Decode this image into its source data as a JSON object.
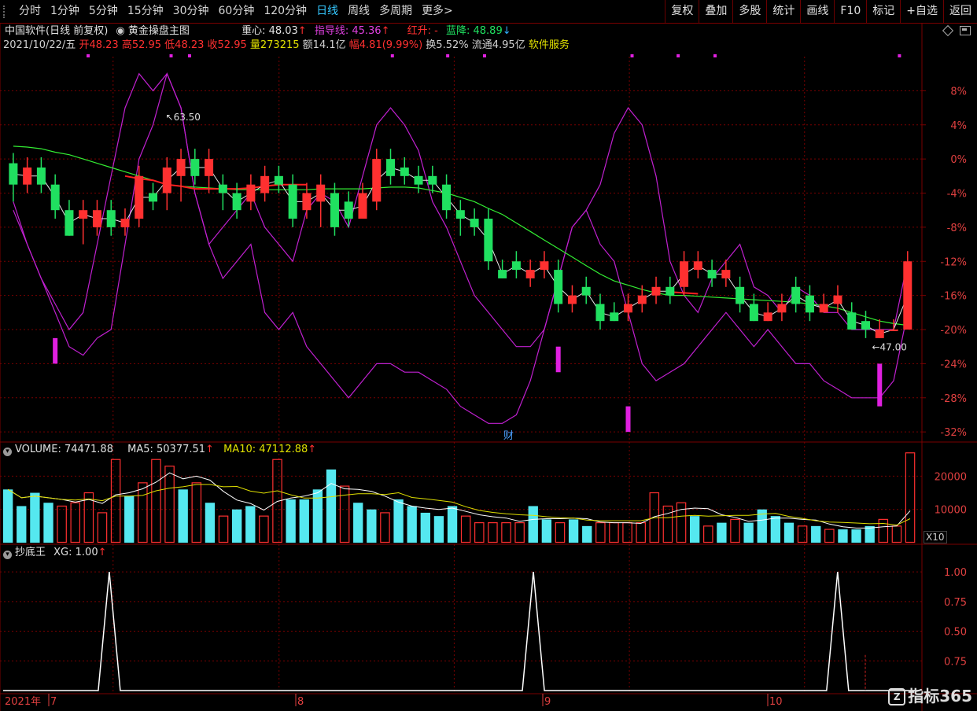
{
  "toolbar": {
    "periods": [
      "分时",
      "1分钟",
      "5分钟",
      "15分钟",
      "30分钟",
      "60分钟",
      "120分钟",
      "日线",
      "周线",
      "多周期",
      "更多>"
    ],
    "active_period": "日线",
    "buttons": [
      "复权",
      "叠加",
      "多股",
      "统计",
      "画线",
      "F10",
      "标记",
      "+自选",
      "返回"
    ]
  },
  "header": {
    "stock_name": "中国软件(日线 前复权)",
    "indicator_name": "黄金操盘主图",
    "zhongxin_label": "重心: 48.03",
    "zhidao_label": "指导线: 45.36",
    "hongsheng_label": "红升: -",
    "lanjiang_label": "蓝降: 48.89",
    "date": "2021/10/22/五",
    "open": "开48.23",
    "high": "高52.95",
    "low": "低48.23",
    "close": "收52.95",
    "volume": "量273215",
    "amount": "额14.1亿",
    "change": "幅4.81(9.99%)",
    "turnover": "换5.52%",
    "float": "流通4.95亿",
    "sector": "软件服务"
  },
  "main_axis": {
    "ticks": [
      "8%",
      "4%",
      "0%",
      "-4%",
      "-8%",
      "-12%",
      "-16%",
      "-20%",
      "-24%",
      "-28%",
      "-32%"
    ],
    "tick_values": [
      8,
      4,
      0,
      -4,
      -8,
      -12,
      -16,
      -20,
      -24,
      -28,
      -32
    ],
    "high_note": "63.50",
    "low_note": "47.00",
    "cai_marker": "财"
  },
  "volume_panel": {
    "title": "VOLUME: 74471.88",
    "ma5": "MA5: 50377.51",
    "ma10": "MA10: 47112.88",
    "ticks": [
      "20000",
      "10000"
    ],
    "unit_badge": "X10"
  },
  "xg_panel": {
    "title": "抄底王",
    "xg": "XG: 1.00",
    "ticks": [
      "1.00",
      "0.75",
      "0.50",
      "0.75"
    ]
  },
  "dates": {
    "labels": [
      "2021年",
      "7",
      "8",
      "9",
      "10"
    ]
  },
  "watermark": {
    "icon": "Z",
    "text": "指标365"
  },
  "colors": {
    "up": "#ff3030",
    "down": "#20e060",
    "magenta": "#e020e0",
    "green_line": "#33ee33",
    "red_line": "#ff2020",
    "grid": "#7a0000"
  },
  "chart_data": {
    "type": "candlestick",
    "title": "黄金操盘主图",
    "y_unit": "%",
    "ylim": [
      -33,
      12
    ],
    "candles": [
      [
        1,
        -0.5,
        -3,
        -5,
        "d"
      ],
      [
        2,
        -3,
        -1,
        -4,
        "u"
      ],
      [
        3,
        -1,
        -3,
        -4,
        "d"
      ],
      [
        4,
        -3,
        -6,
        -7,
        "d"
      ],
      [
        5,
        -6,
        -9,
        -9,
        "d"
      ],
      [
        6,
        -7,
        -6,
        -10,
        "u"
      ],
      [
        7,
        -8,
        -6,
        -9,
        "u"
      ],
      [
        8,
        -6,
        -8,
        -9,
        "d"
      ],
      [
        9,
        -8,
        -7,
        -9,
        "u"
      ],
      [
        10,
        -7,
        -2,
        -8,
        "u"
      ],
      [
        11,
        -4,
        -5,
        -6,
        "d"
      ],
      [
        12,
        -4,
        -1,
        -6,
        "u"
      ],
      [
        13,
        -2,
        0,
        -5,
        "u"
      ],
      [
        14,
        0,
        -2,
        -3,
        "d"
      ],
      [
        15,
        -2,
        0,
        -4,
        "u"
      ],
      [
        16,
        -3,
        -4,
        -6,
        "d"
      ],
      [
        17,
        -4,
        -6,
        -7,
        "d"
      ],
      [
        18,
        -5,
        -3,
        -6,
        "u"
      ],
      [
        19,
        -4,
        -2,
        -5,
        "u"
      ],
      [
        20,
        -2,
        -3,
        -4,
        "d"
      ],
      [
        21,
        -3,
        -7,
        -8,
        "d"
      ],
      [
        22,
        -6,
        -4,
        -7,
        "u"
      ],
      [
        23,
        -5,
        -3,
        -8,
        "u"
      ],
      [
        24,
        -4,
        -8,
        -9,
        "d"
      ],
      [
        25,
        -5,
        -7,
        -8,
        "d"
      ],
      [
        26,
        -7,
        -4,
        -7,
        "u"
      ],
      [
        27,
        -5,
        0,
        -6,
        "u"
      ],
      [
        28,
        0,
        -2,
        -3,
        "d"
      ],
      [
        29,
        -1,
        -2,
        -3,
        "d"
      ],
      [
        30,
        -2,
        -3,
        -4,
        "d"
      ],
      [
        31,
        -2,
        -3,
        -4,
        "d"
      ],
      [
        32,
        -3,
        -6,
        -7,
        "d"
      ],
      [
        33,
        -6,
        -7,
        -9,
        "d"
      ],
      [
        34,
        -7,
        -8,
        -9,
        "d"
      ],
      [
        35,
        -7,
        -12,
        -13,
        "d"
      ],
      [
        36,
        -13,
        -14,
        -14,
        "d"
      ],
      [
        37,
        -12,
        -13,
        -14,
        "d"
      ],
      [
        38,
        -14,
        -13,
        -15,
        "u"
      ],
      [
        39,
        -13,
        -12,
        -14,
        "u"
      ],
      [
        40,
        -13,
        -17,
        -18,
        "d"
      ],
      [
        41,
        -17,
        -16,
        -18,
        "u"
      ],
      [
        42,
        -15,
        -16,
        -17,
        "d"
      ],
      [
        43,
        -17,
        -19,
        -20,
        "d"
      ],
      [
        44,
        -18,
        -19,
        -19,
        "d"
      ],
      [
        45,
        -18,
        -17,
        -19,
        "u"
      ],
      [
        46,
        -17,
        -16,
        -18,
        "u"
      ],
      [
        47,
        -16,
        -15,
        -17,
        "u"
      ],
      [
        48,
        -15,
        -16,
        -17,
        "d"
      ],
      [
        49,
        -12,
        -15,
        -16,
        "u"
      ],
      [
        50,
        -13,
        -12,
        -14,
        "u"
      ],
      [
        51,
        -13,
        -14,
        -15,
        "d"
      ],
      [
        52,
        -13,
        -14,
        -15,
        "u"
      ],
      [
        53,
        -15,
        -17,
        -18,
        "d"
      ],
      [
        54,
        -17,
        -19,
        -19,
        "d"
      ],
      [
        55,
        -18,
        -19,
        -19,
        "u"
      ],
      [
        56,
        -17,
        -18,
        -19,
        "u"
      ],
      [
        57,
        -15,
        -17,
        -18,
        "d"
      ],
      [
        58,
        -16,
        -18,
        -19,
        "d"
      ],
      [
        59,
        -17,
        -18,
        -18,
        "u"
      ],
      [
        60,
        -16,
        -17,
        -18,
        "u"
      ],
      [
        61,
        -18,
        -20,
        -20,
        "d"
      ],
      [
        62,
        -19,
        -20,
        -21,
        "d"
      ],
      [
        63,
        -20,
        -21,
        -21,
        "u"
      ],
      [
        64,
        -20,
        -20,
        -20,
        "u"
      ],
      [
        65,
        -12,
        -20,
        -20,
        "u"
      ]
    ],
    "zhongxin_line": [
      -1,
      -1,
      -1.5,
      -2,
      -2.5,
      -3,
      -3.5,
      -4,
      -4.5,
      -5,
      -5.5,
      -6,
      -7,
      -8,
      -9,
      -10,
      -11,
      -12,
      -13,
      -14,
      -15,
      -16,
      -16.5,
      -17,
      -17.5,
      -18,
      -18.5,
      -19
    ],
    "volume": [
      [
        1,
        16,
        "d"
      ],
      [
        2,
        11,
        "d"
      ],
      [
        3,
        15,
        "d"
      ],
      [
        4,
        12,
        "d"
      ],
      [
        5,
        11,
        "u"
      ],
      [
        6,
        12,
        "u"
      ],
      [
        7,
        15,
        "u"
      ],
      [
        8,
        9,
        "u"
      ],
      [
        9,
        25,
        "u"
      ],
      [
        10,
        14,
        "d"
      ],
      [
        11,
        18,
        "u"
      ],
      [
        12,
        25,
        "u"
      ],
      [
        13,
        23,
        "u"
      ],
      [
        14,
        16,
        "d"
      ],
      [
        15,
        18,
        "u"
      ],
      [
        16,
        12,
        "d"
      ],
      [
        17,
        8,
        "u"
      ],
      [
        18,
        10,
        "d"
      ],
      [
        19,
        11,
        "d"
      ],
      [
        20,
        8,
        "u"
      ],
      [
        21,
        25,
        "u"
      ],
      [
        22,
        13,
        "d"
      ],
      [
        23,
        13,
        "d"
      ],
      [
        24,
        16,
        "d"
      ],
      [
        25,
        22,
        "d"
      ],
      [
        26,
        17,
        "u"
      ],
      [
        27,
        12,
        "d"
      ],
      [
        28,
        10,
        "d"
      ],
      [
        29,
        9,
        "u"
      ],
      [
        30,
        13,
        "d"
      ],
      [
        31,
        11,
        "d"
      ],
      [
        32,
        9,
        "d"
      ],
      [
        33,
        8,
        "d"
      ],
      [
        34,
        11,
        "d"
      ],
      [
        35,
        8,
        "u"
      ],
      [
        36,
        6,
        "u"
      ],
      [
        37,
        6,
        "u"
      ],
      [
        38,
        6,
        "u"
      ],
      [
        39,
        6,
        "u"
      ],
      [
        40,
        11,
        "d"
      ],
      [
        41,
        7,
        "d"
      ],
      [
        42,
        6,
        "u"
      ],
      [
        43,
        7,
        "d"
      ],
      [
        44,
        5,
        "d"
      ],
      [
        45,
        6,
        "u"
      ],
      [
        46,
        6,
        "u"
      ],
      [
        47,
        6,
        "u"
      ],
      [
        48,
        6,
        "u"
      ],
      [
        49,
        15,
        "u"
      ],
      [
        50,
        11,
        "u"
      ],
      [
        51,
        12,
        "u"
      ],
      [
        52,
        8,
        "d"
      ],
      [
        53,
        5,
        "u"
      ],
      [
        54,
        6,
        "d"
      ],
      [
        55,
        7,
        "u"
      ],
      [
        56,
        6,
        "d"
      ],
      [
        57,
        10,
        "d"
      ],
      [
        58,
        8,
        "d"
      ],
      [
        59,
        6,
        "d"
      ],
      [
        60,
        5,
        "u"
      ],
      [
        61,
        5,
        "d"
      ],
      [
        62,
        4,
        "u"
      ],
      [
        63,
        4,
        "d"
      ],
      [
        64,
        4,
        "d"
      ],
      [
        65,
        5,
        "d"
      ],
      [
        66,
        7,
        "u"
      ],
      [
        67,
        5,
        "u"
      ],
      [
        68,
        27,
        "u"
      ]
    ],
    "volume_ylim": [
      0,
      26000
    ],
    "xg_spikes_x": [
      0.11,
      0.57,
      0.9
    ],
    "xg_ylim": [
      0,
      1.1
    ]
  }
}
